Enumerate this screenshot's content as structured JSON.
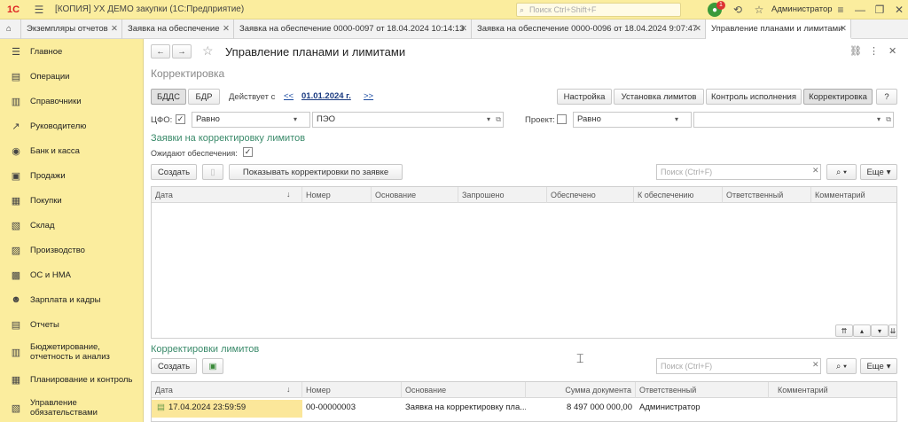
{
  "app": {
    "title": "[КОПИЯ] УХ ДЕМО закупки  (1С:Предприятие)",
    "search_placeholder": "Поиск Ctrl+Shift+F",
    "user": "Администратор",
    "notification_count": "1"
  },
  "tabs": [
    {
      "label": "Экземпляры отчетов"
    },
    {
      "label": "Заявка на обеспечение"
    },
    {
      "label": "Заявка на обеспечение 0000-0097 от 18.04.2024 10:14:13"
    },
    {
      "label": "Заявка на обеспечение 0000-0096 от 18.04.2024 9:07:47"
    },
    {
      "label": "Управление планами и лимитами"
    }
  ],
  "sidebar": {
    "items": [
      {
        "label": "Главное",
        "icon": "menu-icon"
      },
      {
        "label": "Операции",
        "icon": "operations-icon"
      },
      {
        "label": "Справочники",
        "icon": "catalog-icon"
      },
      {
        "label": "Руководителю",
        "icon": "chart-icon"
      },
      {
        "label": "Банк и касса",
        "icon": "bank-icon"
      },
      {
        "label": "Продажи",
        "icon": "sales-icon"
      },
      {
        "label": "Покупки",
        "icon": "purchases-icon"
      },
      {
        "label": "Склад",
        "icon": "warehouse-icon"
      },
      {
        "label": "Производство",
        "icon": "production-icon"
      },
      {
        "label": "ОС и НМА",
        "icon": "assets-icon"
      },
      {
        "label": "Зарплата и кадры",
        "icon": "salary-icon"
      },
      {
        "label": "Отчеты",
        "icon": "reports-icon"
      },
      {
        "label": "Бюджетирование, отчетность и анализ",
        "icon": "budget-icon"
      },
      {
        "label": "Планирование и контроль",
        "icon": "planning-icon"
      },
      {
        "label": "Управление обязательствами",
        "icon": "obligations-icon"
      }
    ]
  },
  "form": {
    "title": "Управление планами и лимитами",
    "subtitle": "Корректировка",
    "bdds": "БДДС",
    "bdr": "БДР",
    "valid_from": "Действует с",
    "nav_prev": "<<",
    "date": "01.01.2024 г.",
    "nav_next": ">>",
    "top_buttons": [
      "Настройка",
      "Установка лимитов",
      "Контроль исполнения",
      "Корректировка",
      "?"
    ],
    "cfo_label": "ЦФО:",
    "cfo_cond": "Равно",
    "cfo_value": "ПЭО",
    "project_label": "Проект:",
    "project_cond": "Равно",
    "project_value": ""
  },
  "requests": {
    "section_title": "Заявки на корректировку лимитов",
    "awaiting_label": "Ожидают обеспечения:",
    "create": "Создать",
    "show_btn": "Показывать корректировки по заявке",
    "search_placeholder": "Поиск (Ctrl+F)",
    "more": "Еще",
    "columns": [
      "Дата",
      "Номер",
      "Основание",
      "Запрошено",
      "Обеспечено",
      "К обеспечению",
      "Ответственный",
      "Комментарий"
    ]
  },
  "corrections": {
    "section_title": "Корректировки лимитов",
    "create": "Создать",
    "search_placeholder": "Поиск (Ctrl+F)",
    "more": "Еще",
    "columns": [
      "Дата",
      "Номер",
      "Основание",
      "Сумма документа",
      "Ответственный",
      "Комментарий"
    ],
    "rows": [
      {
        "date": "17.04.2024 23:59:59",
        "number": "00-00000003",
        "basis": "Заявка на корректировку пла...",
        "amount": "8 497 000 000,00",
        "responsible": "Администратор",
        "comment": ""
      }
    ]
  }
}
